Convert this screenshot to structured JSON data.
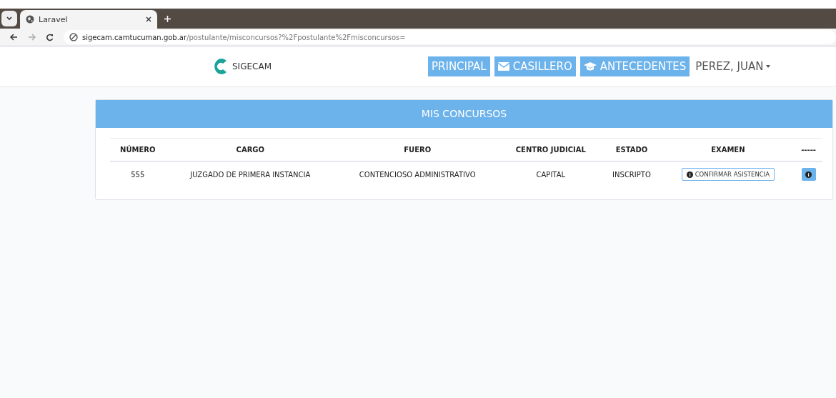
{
  "browser": {
    "tab_title": "Laravel",
    "address_host": "sigecam.camtucuman.gob.ar",
    "address_path": "/postulante/misconcursos?%2Fpostulante%2Fmisconcursos="
  },
  "navbar": {
    "brand": "SIGECAM",
    "links": [
      {
        "label": "PRINCIPAL",
        "kind": "plain"
      },
      {
        "label": "CASILLERO",
        "kind": "mail"
      },
      {
        "label": "ANTECEDENTES",
        "kind": "studies"
      }
    ],
    "user": "PEREZ, JUAN"
  },
  "panel": {
    "title": "MIS CONCURSOS",
    "table": {
      "columns": [
        "NÚMERO",
        "CARGO",
        "FUERO",
        "CENTRO JUDICIAL",
        "ESTADO",
        "EXAMEN",
        "-----"
      ],
      "rows": [
        {
          "cells": [
            "555",
            "JUZGADO DE PRIMERA INSTANCIA",
            "CONTENCIOSO ADMINISTRATIVO",
            "CAPITAL",
            "INSCRIPTO"
          ],
          "action": "CONFIRMAR ASISTENCIA"
        }
      ]
    }
  }
}
